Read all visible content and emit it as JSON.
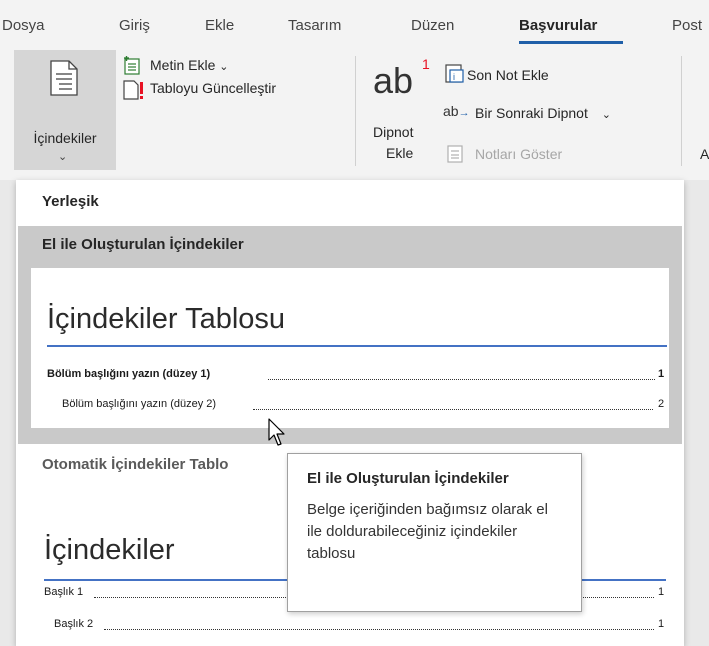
{
  "tabs": [
    "Dosya",
    "Giriş",
    "Ekle",
    "Tasarım",
    "Düzen",
    "Başvurular",
    "Post"
  ],
  "active_tab": "Başvurular",
  "ribbon": {
    "toc_button": "İçindekiler",
    "add_text": "Metin Ekle",
    "update_table": "Tabloyu Güncelleştir",
    "footnote_icon_text": "ab",
    "footnote_sup": "1",
    "insert_footnote_line1": "Dipnot",
    "insert_footnote_line2": "Ekle",
    "insert_endnote": "Son Not Ekle",
    "next_footnote": "Bir Sonraki Dipnot",
    "show_notes": "Notları Göster",
    "partial_right": "A"
  },
  "gallery": {
    "section_builtin": "Yerleşik",
    "manual_title": "El ile Oluşturulan İçindekiler",
    "manual_heading": "İçindekiler Tablosu",
    "manual_entries": [
      {
        "text": "Bölüm başlığını yazın (düzey 1)",
        "page": "1"
      },
      {
        "text": "Bölüm başlığını yazın (düzey 2)",
        "page": "2"
      }
    ],
    "auto_title": "Otomatik İçindekiler Tablo",
    "auto_heading": "İçindekiler",
    "auto_entries": [
      {
        "text": "Başlık 1",
        "page": "1"
      },
      {
        "text": "Başlık 2",
        "page": "1"
      }
    ]
  },
  "tooltip": {
    "title": "El ile Oluşturulan İçindekiler",
    "body": "Belge içeriğinden bağımsız olarak el ile doldurabileceğiniz içindekiler tablosu"
  },
  "colors": {
    "accent": "#1f5fa8",
    "heading_rule": "#4472c4",
    "hover": "#c9c9c9",
    "error_red": "#e81123"
  }
}
